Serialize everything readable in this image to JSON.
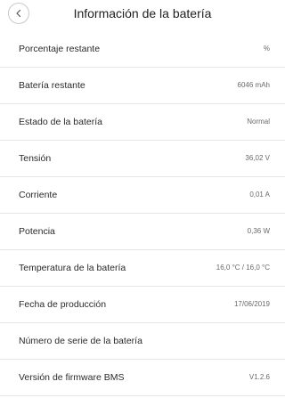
{
  "header": {
    "title": "Información de la batería",
    "back_icon": "chevron-left-icon"
  },
  "rows": [
    {
      "label": "Porcentaje restante",
      "value": "%"
    },
    {
      "label": "Batería restante",
      "value": "6046 mAh"
    },
    {
      "label": "Estado de la batería",
      "value": "Normal"
    },
    {
      "label": "Tensión",
      "value": "36,02 V"
    },
    {
      "label": "Corriente",
      "value": "0,01 A"
    },
    {
      "label": "Potencia",
      "value": "0,36 W"
    },
    {
      "label": "Temperatura de la batería",
      "value": "16,0 °C / 16,0 °C"
    },
    {
      "label": "Fecha de producción",
      "value": "17/06/2019"
    },
    {
      "label": "Número de serie de la batería",
      "value": ""
    },
    {
      "label": "Versión de firmware BMS",
      "value": "V1.2.6"
    }
  ]
}
